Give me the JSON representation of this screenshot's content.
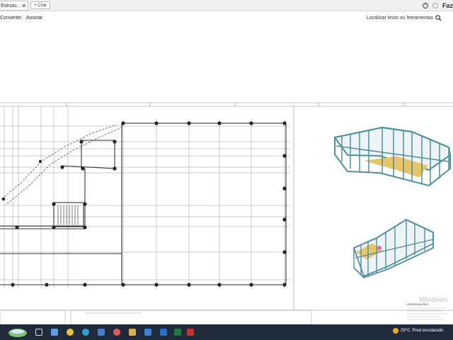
{
  "browser": {
    "tab_title": "Estrutu...",
    "tab_close": "✕",
    "new_tab_label": "+ Criar",
    "user_label": "Faz"
  },
  "toolbar": {
    "convert_label": "Converter",
    "sign_label": "Assinar",
    "search_label": "Localizar texto ou ferramentas"
  },
  "document": {
    "watermark": "Windows",
    "notes_title": "OBSERVAÇÕES"
  },
  "taskbar": {
    "weather_temp": "29°C",
    "weather_desc": "Pred ensolarado",
    "icons": [
      "task-view-icon",
      "file-explorer-icon",
      "chrome-icon",
      "edge-icon",
      "store-icon",
      "paint-icon",
      "photos-icon",
      "mail-icon",
      "excel-icon",
      "acrobat-icon"
    ]
  },
  "colors": {
    "tabbar": "#f0f0f0",
    "taskbar": "#1f2b3a",
    "model_frame": "#4f8fa0",
    "model_slab": "#e8c46a"
  }
}
